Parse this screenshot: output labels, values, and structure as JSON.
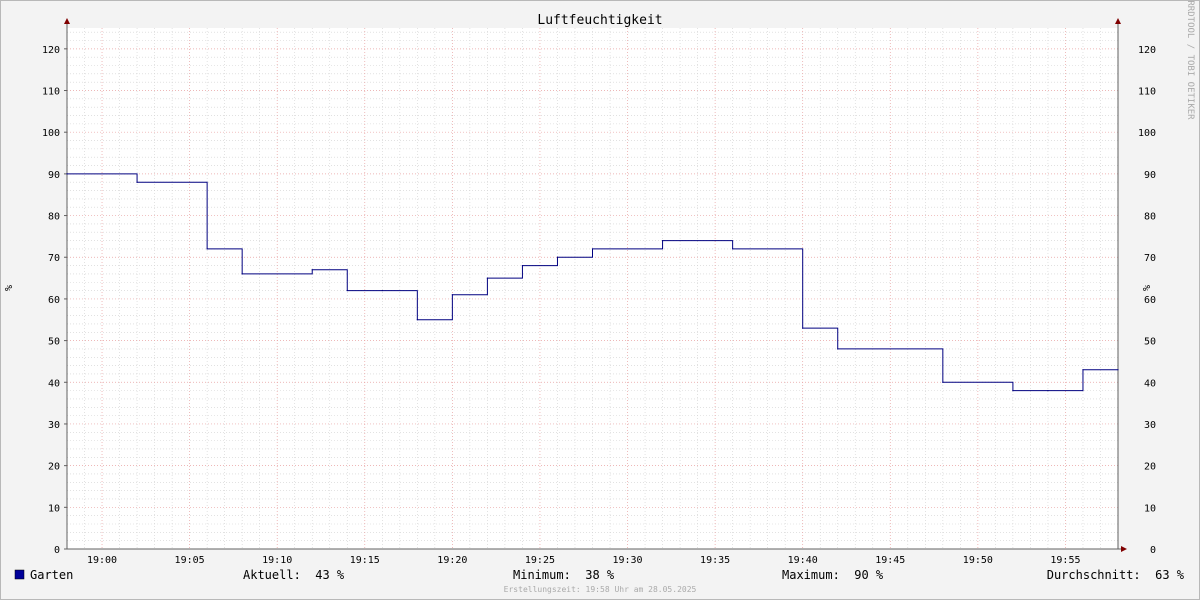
{
  "chart_data": {
    "type": "line",
    "step": true,
    "title": "Luftfeuchtigkeit",
    "ylabel": "%",
    "side_label": "RRDTOOL / TOBI OETIKER",
    "ylim": [
      0,
      125
    ],
    "yticks": [
      0,
      10,
      20,
      30,
      40,
      50,
      60,
      70,
      80,
      90,
      100,
      110,
      120
    ],
    "x_range": [
      "18:58",
      "19:58"
    ],
    "xticks": [
      "19:00",
      "19:05",
      "19:10",
      "19:15",
      "19:20",
      "19:25",
      "19:30",
      "19:35",
      "19:40",
      "19:45",
      "19:50",
      "19:55"
    ],
    "grid": true,
    "colors": {
      "series": "#000080",
      "major_grid": "#e8a0a0",
      "minor_grid": "#d0d0d0",
      "axis": "#606060",
      "arrow": "#800000",
      "canvas": "#ffffff",
      "background": "#f3f3f3"
    },
    "series": [
      {
        "name": "Garten",
        "x": [
          "18:58",
          "19:02",
          "19:06",
          "19:08",
          "19:12",
          "19:14",
          "19:16",
          "19:18",
          "19:20",
          "19:22",
          "19:24",
          "19:26",
          "19:28",
          "19:32",
          "19:36",
          "19:40",
          "19:42",
          "19:48",
          "19:52",
          "19:54",
          "19:56",
          "19:58"
        ],
        "values": [
          90,
          88,
          72,
          66,
          67,
          62,
          62,
          55,
          61,
          65,
          68,
          70,
          72,
          74,
          72,
          53,
          48,
          40,
          38,
          38,
          43,
          43
        ]
      }
    ],
    "legend": {
      "placement": "bottom-left",
      "name": "Garten",
      "color": "#000099"
    },
    "stats": {
      "current": "Aktuell:  43 %",
      "minimum": "Minimum:  38 %",
      "maximum": "Maximum:  90 %",
      "average": "Durchschnitt:  63 %"
    },
    "created": "Erstellungszeit: 19:58 Uhr am 28.05.2025"
  }
}
